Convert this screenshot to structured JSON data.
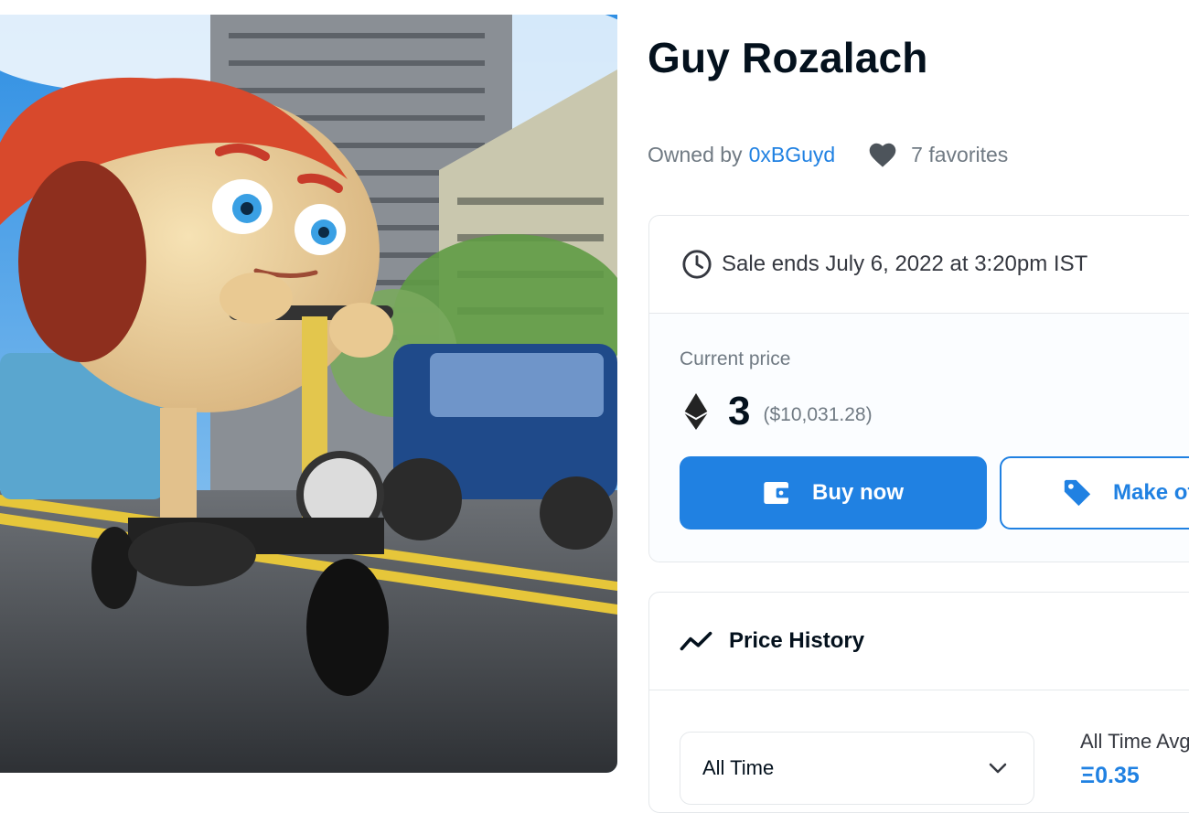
{
  "item": {
    "title": "Guy Rozalach",
    "owned_by_label": "Owned by",
    "owner": "0xBGuyd",
    "favorites": "7 favorites"
  },
  "sale": {
    "ends_text": "Sale ends July 6, 2022 at 3:20pm IST",
    "current_price_label": "Current price",
    "price": "3",
    "price_usd": "($10,031.28)",
    "buy_label": "Buy now",
    "offer_label": "Make offer"
  },
  "price_history": {
    "title": "Price History",
    "range_selected": "All Time",
    "all_time_avg_label": "All Time Avg. Price",
    "all_time_avg_value": "Ξ0.35"
  },
  "colors": {
    "accent": "#2081e2",
    "text": "#04111d",
    "muted": "#707a83",
    "border": "#e5e8eb"
  },
  "icons": {
    "heart": "heart-icon",
    "clock": "clock-icon",
    "eth": "ethereum-icon",
    "wallet": "wallet-icon",
    "tag": "tag-icon",
    "trend": "trend-icon",
    "chevron": "chevron-down-icon"
  }
}
